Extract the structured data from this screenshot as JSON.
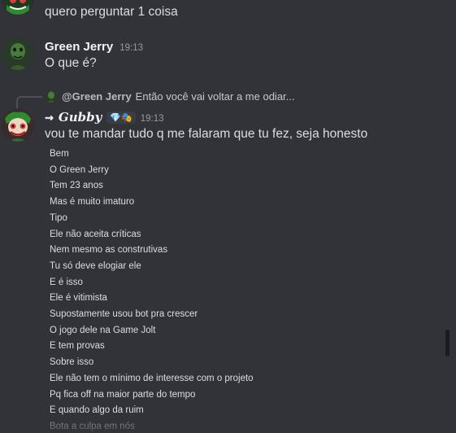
{
  "messages": {
    "top_continuation": {
      "text": "quero perguntar 1 coisa"
    },
    "green_jerry": {
      "author": "Green Jerry",
      "time": "19:13",
      "text": "O que é?"
    },
    "gubby": {
      "reply": {
        "author": "@Green Jerry",
        "text": "Então você vai voltar a me odiar..."
      },
      "author_prefix": "⇝",
      "author": "Gubby",
      "role_badge": "💎🎭",
      "time": "19:13",
      "text": "vou te mandar tudo q me falaram que tu fez, seja honesto",
      "lines": [
        "Bem",
        "O Green Jerry",
        "Tem 23 anos",
        "Mas é muito imaturo",
        "Tipo",
        "Ele não aceita críticas",
        "Nem mesmo as construtivas",
        "Tu só deve elogiar ele",
        "E é isso",
        "Ele é vitimista",
        "Supostamente usou bot pra crescer",
        "O jogo dele na Game Jolt",
        "E tem provas",
        "Sobre isso",
        "Ele não tem o mínimo de interesse com o projeto",
        "Pq fica off na maior parte do tempo",
        "E quando algo da ruim",
        "Bota a culpa em nós"
      ]
    }
  },
  "colors": {
    "background": "#313338",
    "text": "#dbdee1",
    "muted": "#949ba4",
    "author": "#f2f3f5"
  },
  "icons": {
    "scrollbar": "scrollbar-thumb"
  }
}
